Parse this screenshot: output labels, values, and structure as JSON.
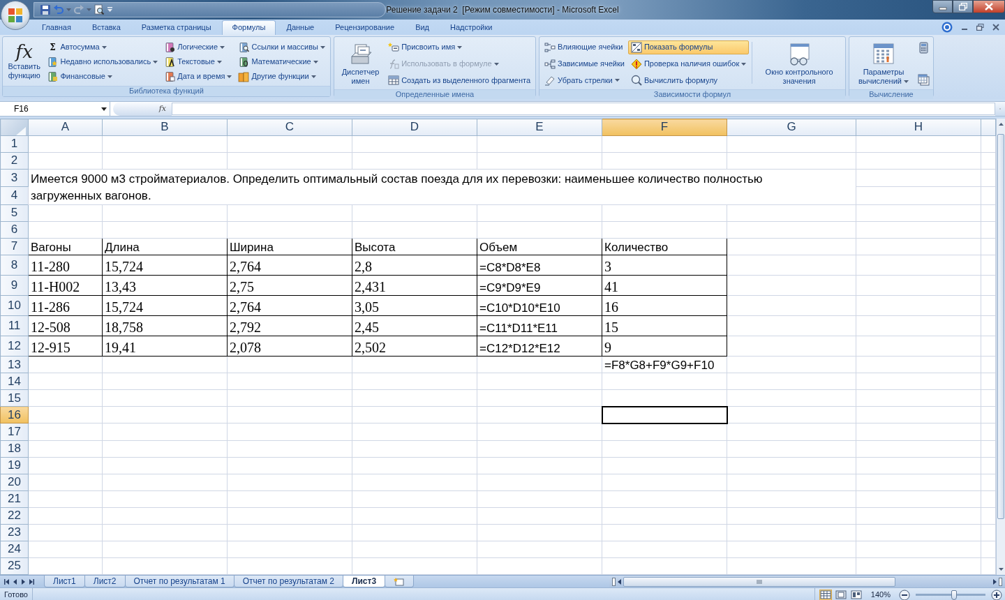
{
  "window": {
    "title": "Решение задачи 2  [Режим совместимости] - Microsoft Excel"
  },
  "ribbon_tabs": [
    {
      "label": "Главная",
      "selected": false
    },
    {
      "label": "Вставка",
      "selected": false
    },
    {
      "label": "Разметка страницы",
      "selected": false
    },
    {
      "label": "Формулы",
      "selected": true
    },
    {
      "label": "Данные",
      "selected": false
    },
    {
      "label": "Рецензирование",
      "selected": false
    },
    {
      "label": "Вид",
      "selected": false
    },
    {
      "label": "Надстройки",
      "selected": false
    }
  ],
  "ribbon_groups": [
    {
      "label": "Библиотека функций",
      "columns": [
        [
          {
            "kind": "large",
            "glyph": "fx",
            "label": "Вставить функцию",
            "dropdown": false,
            "disabled": false,
            "on": false
          }
        ],
        [
          {
            "kind": "small",
            "glyph": "Σ",
            "label": "Автосумма",
            "dropdown": true,
            "disabled": false,
            "on": false
          },
          {
            "kind": "small",
            "label": "Недавно использовались",
            "dropdown": true,
            "disabled": false,
            "on": false
          },
          {
            "kind": "small",
            "label": "Финансовые",
            "dropdown": true,
            "disabled": false,
            "on": false
          }
        ],
        [
          {
            "kind": "small",
            "label": "Логические",
            "dropdown": true,
            "disabled": false,
            "on": false
          },
          {
            "kind": "small",
            "label": "Текстовые",
            "dropdown": true,
            "disabled": false,
            "on": false
          },
          {
            "kind": "small",
            "label": "Дата и время",
            "dropdown": true,
            "disabled": false,
            "on": false
          }
        ],
        [
          {
            "kind": "small",
            "label": "Ссылки и массивы",
            "dropdown": true,
            "disabled": false,
            "on": false
          },
          {
            "kind": "small",
            "label": "Математические",
            "dropdown": true,
            "disabled": false,
            "on": false
          },
          {
            "kind": "small",
            "label": "Другие функции",
            "dropdown": true,
            "disabled": false,
            "on": false
          }
        ]
      ]
    },
    {
      "label": "Определенные имена",
      "columns": [
        [
          {
            "kind": "large",
            "label": "Диспетчер имен",
            "dropdown": false,
            "disabled": false,
            "on": false
          }
        ],
        [
          {
            "kind": "small",
            "label": "Присвоить имя",
            "dropdown": true,
            "disabled": false,
            "on": false
          },
          {
            "kind": "small",
            "label": "Использовать в формуле",
            "dropdown": true,
            "disabled": true,
            "on": false
          },
          {
            "kind": "small",
            "label": "Создать из выделенного фрагмента",
            "dropdown": false,
            "disabled": false,
            "on": false
          }
        ]
      ]
    },
    {
      "label": "Зависимости формул",
      "columns": [
        [
          {
            "kind": "small",
            "label": "Влияющие ячейки",
            "dropdown": false,
            "disabled": false,
            "on": false
          },
          {
            "kind": "small",
            "label": "Зависимые ячейки",
            "dropdown": false,
            "disabled": false,
            "on": false
          },
          {
            "kind": "small",
            "label": "Убрать стрелки",
            "dropdown": true,
            "disabled": false,
            "on": false
          }
        ],
        [
          {
            "kind": "small",
            "label": "Показать формулы",
            "dropdown": false,
            "disabled": false,
            "on": true
          },
          {
            "kind": "small",
            "label": "Проверка наличия ошибок",
            "dropdown": true,
            "disabled": false,
            "on": false
          },
          {
            "kind": "small",
            "label": "Вычислить формулу",
            "dropdown": false,
            "disabled": false,
            "on": false
          }
        ],
        [
          {
            "kind": "large",
            "label": "Окно контрольного значения",
            "dropdown": false,
            "disabled": false,
            "on": false
          }
        ]
      ]
    },
    {
      "label": "Вычисление",
      "columns": [
        [
          {
            "kind": "large",
            "label": "Параметры вычислений",
            "dropdown": true,
            "disabled": false,
            "on": false
          }
        ],
        [
          {
            "kind": "icon",
            "dropdown": false,
            "disabled": false,
            "on": false
          },
          {
            "kind": "icon",
            "dropdown": false,
            "disabled": false,
            "on": false
          }
        ]
      ]
    }
  ],
  "formula_bar": {
    "name_box": "F16",
    "function_glyph": "fx"
  },
  "sheet": {
    "columns": [
      {
        "label": "A",
        "selected": false
      },
      {
        "label": "B",
        "selected": false
      },
      {
        "label": "C",
        "selected": false
      },
      {
        "label": "D",
        "selected": false
      },
      {
        "label": "E",
        "selected": false
      },
      {
        "label": "F",
        "selected": true
      },
      {
        "label": "G",
        "selected": false
      },
      {
        "label": "H",
        "selected": false
      }
    ],
    "rows": [
      {
        "label": "1",
        "selected": false
      },
      {
        "label": "2",
        "selected": false
      },
      {
        "label": "3",
        "selected": false
      },
      {
        "label": "4",
        "selected": false
      },
      {
        "label": "5",
        "selected": false
      },
      {
        "label": "6",
        "selected": false
      },
      {
        "label": "7",
        "selected": false
      },
      {
        "label": "8",
        "selected": false
      },
      {
        "label": "9",
        "selected": false
      },
      {
        "label": "10",
        "selected": false
      },
      {
        "label": "11",
        "selected": false
      },
      {
        "label": "12",
        "selected": false
      },
      {
        "label": "13",
        "selected": false
      },
      {
        "label": "14",
        "selected": false
      },
      {
        "label": "15",
        "selected": false
      },
      {
        "label": "16",
        "selected": true
      },
      {
        "label": "17",
        "selected": false
      },
      {
        "label": "18",
        "selected": false
      },
      {
        "label": "19",
        "selected": false
      },
      {
        "label": "20",
        "selected": false
      },
      {
        "label": "21",
        "selected": false
      },
      {
        "label": "22",
        "selected": false
      },
      {
        "label": "23",
        "selected": false
      },
      {
        "label": "24",
        "selected": false
      },
      {
        "label": "25",
        "selected": false
      }
    ],
    "note": "Имеется 9000 м3 стройматериалов. Определить оптимальный состав поезда для их перевозки: наименьшее количество полностью загруженных вагонов.",
    "table": {
      "header": [
        "Вагоны",
        "Длина",
        "Ширина",
        "Высота",
        "Объем",
        "Количество"
      ],
      "rows": [
        [
          "11-280",
          "15,724",
          "2,764",
          "2,8",
          "=C8*D8*E8",
          "3"
        ],
        [
          "11-Н002",
          "13,43",
          "2,75",
          "2,431",
          "=C9*D9*E9",
          "41"
        ],
        [
          "11-286",
          "15,724",
          "2,764",
          "3,05",
          "=C10*D10*E10",
          "16"
        ],
        [
          "12-508",
          "18,758",
          "2,792",
          "2,45",
          "=C11*D11*E11",
          "15"
        ],
        [
          "12-915",
          "19,41",
          "2,078",
          "2,502",
          "=C12*D12*E12",
          "9"
        ]
      ]
    },
    "total_formula": "=F8*G8+F9*G9+F10"
  },
  "sheet_tabs": [
    {
      "label": "Лист1",
      "selected": false
    },
    {
      "label": "Лист2",
      "selected": false
    },
    {
      "label": "Отчет по результатам 1",
      "selected": false
    },
    {
      "label": "Отчет по результатам 2",
      "selected": false
    },
    {
      "label": "Лист3",
      "selected": true
    }
  ],
  "status_bar": {
    "text": "Готово",
    "views": [
      {
        "kind": "normal",
        "selected": true
      },
      {
        "kind": "page-layout",
        "selected": false
      },
      {
        "kind": "page-break",
        "selected": false
      }
    ],
    "zoom": "140%",
    "zoom_slider": {
      "level": 0.55
    }
  }
}
